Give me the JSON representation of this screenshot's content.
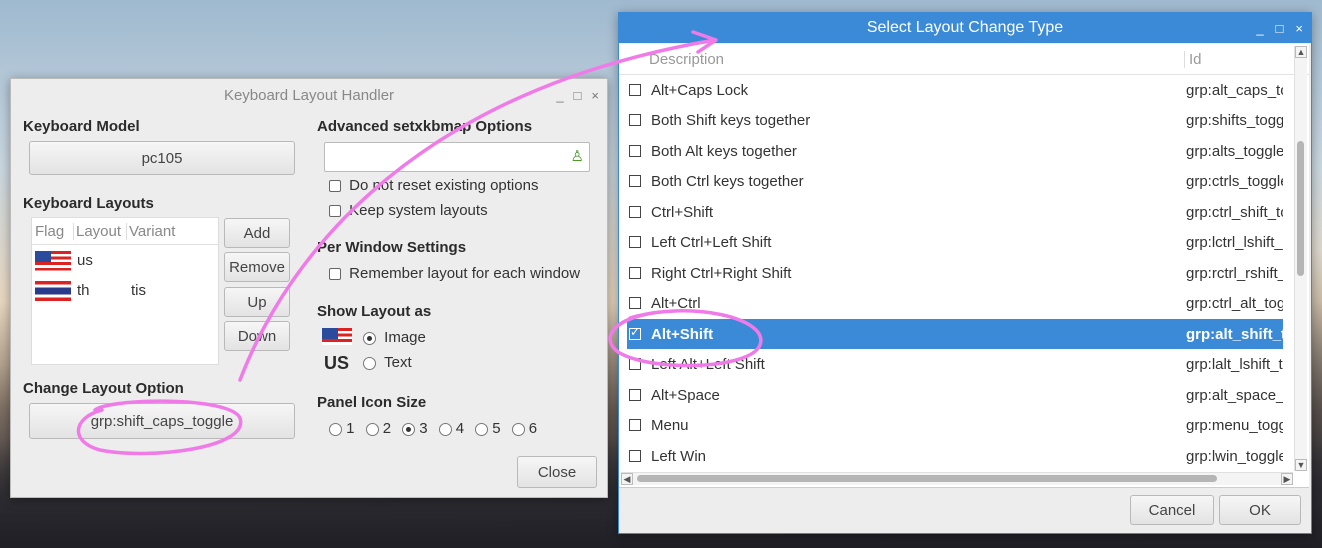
{
  "kbd_window": {
    "title": "Keyboard Layout Handler",
    "controls": [
      "_",
      "□",
      "×"
    ],
    "keyboard_model_heading": "Keyboard Model",
    "keyboard_model_value": "pc105",
    "keyboard_layouts_heading": "Keyboard Layouts",
    "layouts_columns": [
      "Flag",
      "Layout",
      "Variant"
    ],
    "layouts": [
      {
        "flag": "us-flag",
        "layout": "us",
        "variant": ""
      },
      {
        "flag": "th-flag",
        "layout": "th",
        "variant": "tis"
      }
    ],
    "add_label": "Add",
    "remove_label": "Remove",
    "up_label": "Up",
    "down_label": "Down",
    "change_layout_heading": "Change Layout Option",
    "change_layout_value": "grp:shift_caps_toggle",
    "advanced_heading": "Advanced setxkbmap Options",
    "advanced_value": "",
    "no_reset_label": "Do not reset existing options",
    "keep_system_label": "Keep system layouts",
    "per_window_heading": "Per Window Settings",
    "remember_label": "Remember layout for each window",
    "show_layout_heading": "Show Layout as",
    "image_label": "Image",
    "text_label": "Text",
    "us_text": "US",
    "panel_icon_heading": "Panel Icon Size",
    "icon_sizes": [
      "1",
      "2",
      "3",
      "4",
      "5",
      "6"
    ],
    "icon_size_selected": "3",
    "close_label": "Close"
  },
  "select_window": {
    "title": "Select Layout Change Type",
    "controls": [
      "_",
      "□",
      "×"
    ],
    "col_description": "Description",
    "col_id": "Id",
    "rows": [
      {
        "desc": "Alt+Caps Lock",
        "id": "grp:alt_caps_to"
      },
      {
        "desc": "Both Shift keys together",
        "id": "grp:shifts_togg"
      },
      {
        "desc": "Both Alt keys together",
        "id": "grp:alts_toggle"
      },
      {
        "desc": "Both Ctrl keys together",
        "id": "grp:ctrls_toggle"
      },
      {
        "desc": "Ctrl+Shift",
        "id": "grp:ctrl_shift_to"
      },
      {
        "desc": "Left Ctrl+Left Shift",
        "id": "grp:lctrl_lshift_t"
      },
      {
        "desc": "Right Ctrl+Right Shift",
        "id": "grp:rctrl_rshift_"
      },
      {
        "desc": "Alt+Ctrl",
        "id": "grp:ctrl_alt_tog"
      },
      {
        "desc": "Alt+Shift",
        "id": "grp:alt_shift_to"
      },
      {
        "desc": "Left Alt+Left Shift",
        "id": "grp:lalt_lshift_t"
      },
      {
        "desc": "Alt+Space",
        "id": "grp:alt_space_t"
      },
      {
        "desc": "Menu",
        "id": "grp:menu_togg"
      },
      {
        "desc": "Left Win",
        "id": "grp:lwin_toggle"
      }
    ],
    "selected_index": 8,
    "cancel_label": "Cancel",
    "ok_label": "OK"
  },
  "colors": {
    "titlebar_active": "#3b8ad8",
    "selection": "#3b8ad8",
    "annotation": "#f07be8"
  }
}
